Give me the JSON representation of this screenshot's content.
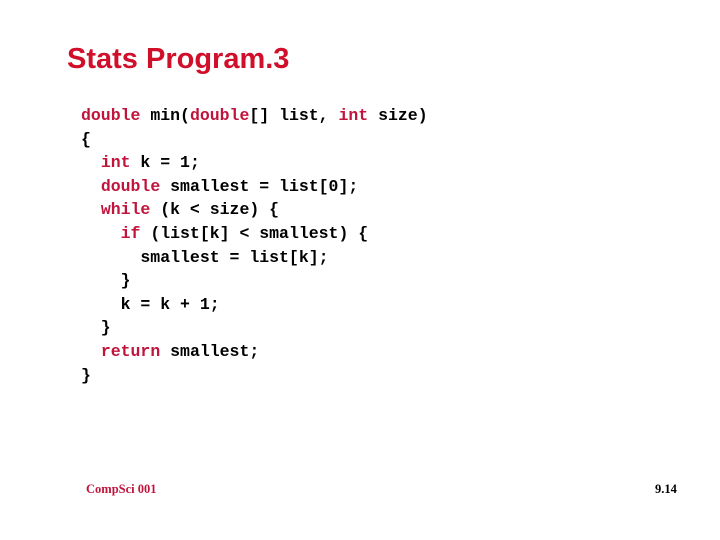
{
  "slide": {
    "title": "Stats Program.3",
    "footer_left": "CompSci 001",
    "page_number": "9.14"
  },
  "colors": {
    "title": "#d0102a",
    "keyword": "#c0143c",
    "text": "#000000"
  },
  "code": [
    [
      {
        "t": "kw",
        "v": "double"
      },
      {
        "t": "n",
        "v": " min("
      },
      {
        "t": "kw",
        "v": "double"
      },
      {
        "t": "n",
        "v": "[] list, "
      },
      {
        "t": "kw",
        "v": "int"
      },
      {
        "t": "n",
        "v": " size)"
      }
    ],
    [
      {
        "t": "n",
        "v": "{"
      }
    ],
    [
      {
        "t": "n",
        "v": "  "
      },
      {
        "t": "kw",
        "v": "int"
      },
      {
        "t": "n",
        "v": " k = 1;"
      }
    ],
    [
      {
        "t": "n",
        "v": "  "
      },
      {
        "t": "kw",
        "v": "double"
      },
      {
        "t": "n",
        "v": " smallest = list[0];"
      }
    ],
    [
      {
        "t": "n",
        "v": "  "
      },
      {
        "t": "kw",
        "v": "while"
      },
      {
        "t": "n",
        "v": " (k < size) {"
      }
    ],
    [
      {
        "t": "n",
        "v": "    "
      },
      {
        "t": "kw",
        "v": "if"
      },
      {
        "t": "n",
        "v": " (list[k] < smallest) {"
      }
    ],
    [
      {
        "t": "n",
        "v": "      smallest = list[k];"
      }
    ],
    [
      {
        "t": "n",
        "v": "    }"
      }
    ],
    [
      {
        "t": "n",
        "v": "    k = k + 1;"
      }
    ],
    [
      {
        "t": "n",
        "v": "  }"
      }
    ],
    [
      {
        "t": "n",
        "v": "  "
      },
      {
        "t": "kw",
        "v": "return"
      },
      {
        "t": "n",
        "v": " smallest;"
      }
    ],
    [
      {
        "t": "n",
        "v": "}"
      }
    ]
  ]
}
